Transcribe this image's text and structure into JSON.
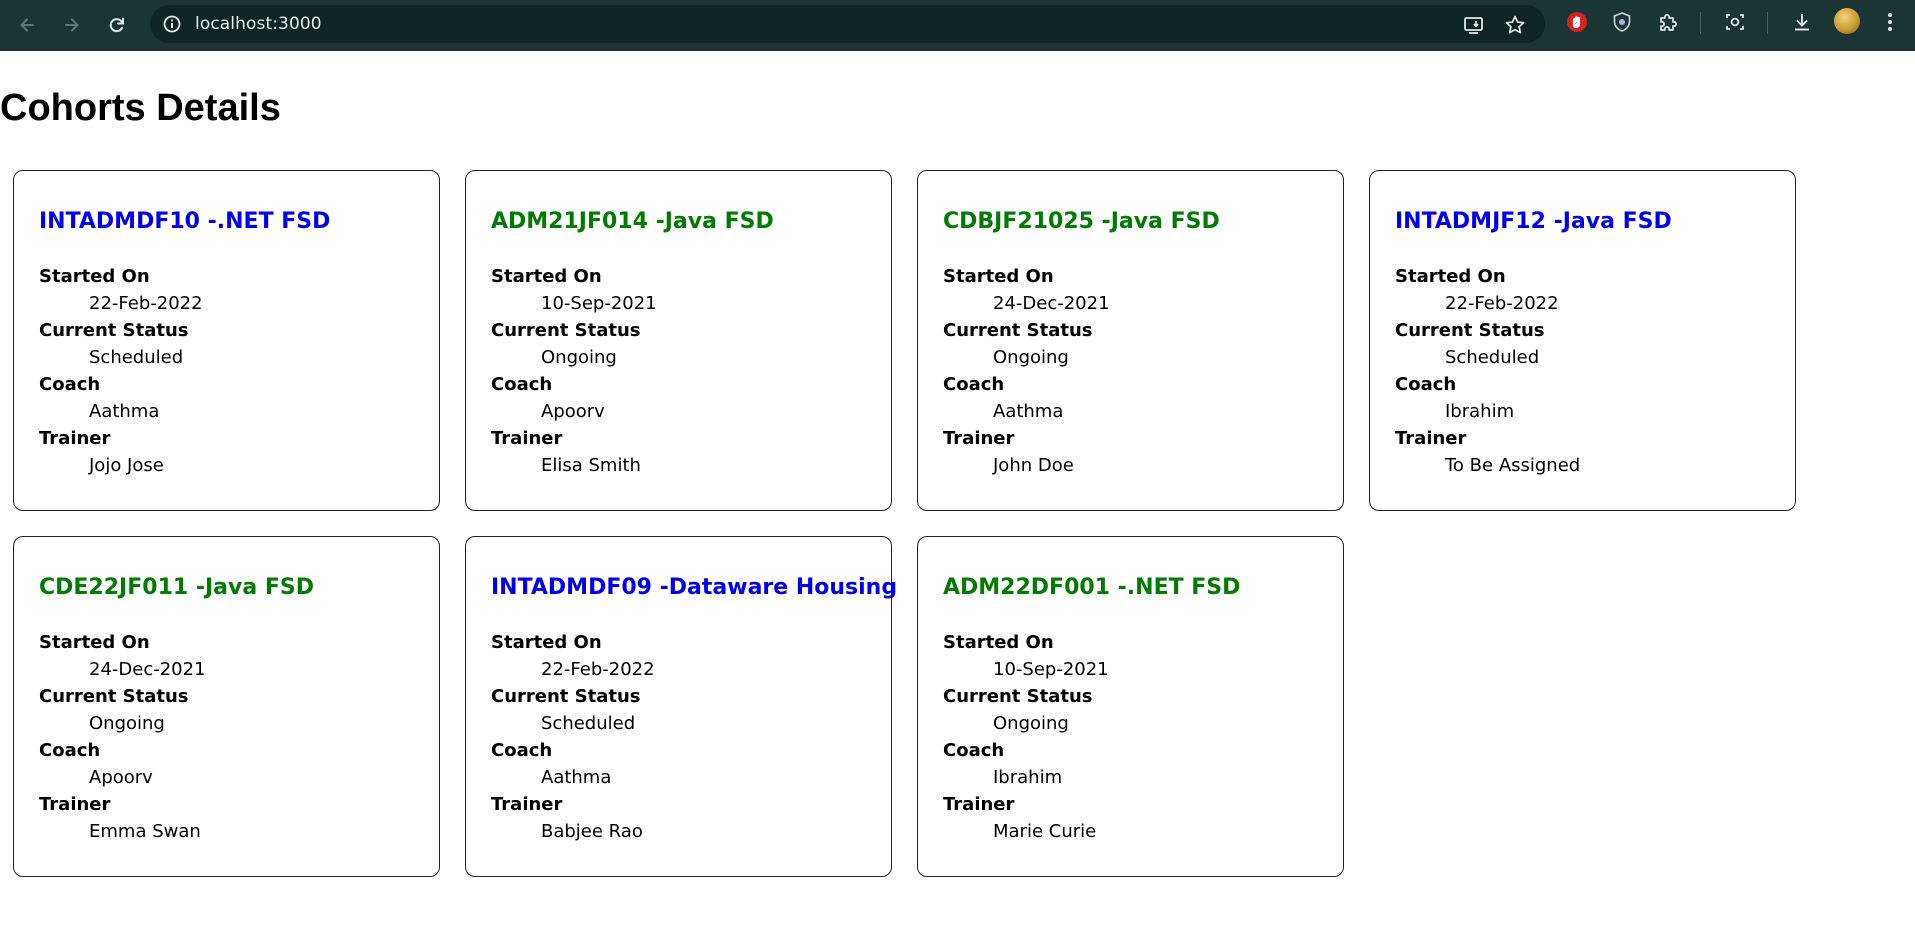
{
  "browser": {
    "url": "localhost:3000"
  },
  "page": {
    "title": "Cohorts Details"
  },
  "labels": {
    "started_on": "Started On",
    "current_status": "Current Status",
    "coach": "Coach",
    "trainer": "Trainer"
  },
  "colors": {
    "scheduled": "#0000ee",
    "ongoing": "#007a00"
  },
  "cohorts": [
    {
      "title": "INTADMDF10 -.NET FSD",
      "started_on": "22-Feb-2022",
      "status": "Scheduled",
      "coach": "Aathma",
      "trainer": "Jojo Jose"
    },
    {
      "title": "ADM21JF014 -Java FSD",
      "started_on": "10-Sep-2021",
      "status": "Ongoing",
      "coach": "Apoorv",
      "trainer": "Elisa Smith"
    },
    {
      "title": "CDBJF21025 -Java FSD",
      "started_on": "24-Dec-2021",
      "status": "Ongoing",
      "coach": "Aathma",
      "trainer": "John Doe"
    },
    {
      "title": "INTADMJF12 -Java FSD",
      "started_on": "22-Feb-2022",
      "status": "Scheduled",
      "coach": "Ibrahim",
      "trainer": "To Be Assigned"
    },
    {
      "title": "CDE22JF011 -Java FSD",
      "started_on": "24-Dec-2021",
      "status": "Ongoing",
      "coach": "Apoorv",
      "trainer": "Emma Swan"
    },
    {
      "title": "INTADMDF09 -Dataware Housing",
      "started_on": "22-Feb-2022",
      "status": "Scheduled",
      "coach": "Aathma",
      "trainer": "Babjee Rao"
    },
    {
      "title": "ADM22DF001 -.NET FSD",
      "started_on": "10-Sep-2021",
      "status": "Ongoing",
      "coach": "Ibrahim",
      "trainer": "Marie Curie"
    }
  ]
}
